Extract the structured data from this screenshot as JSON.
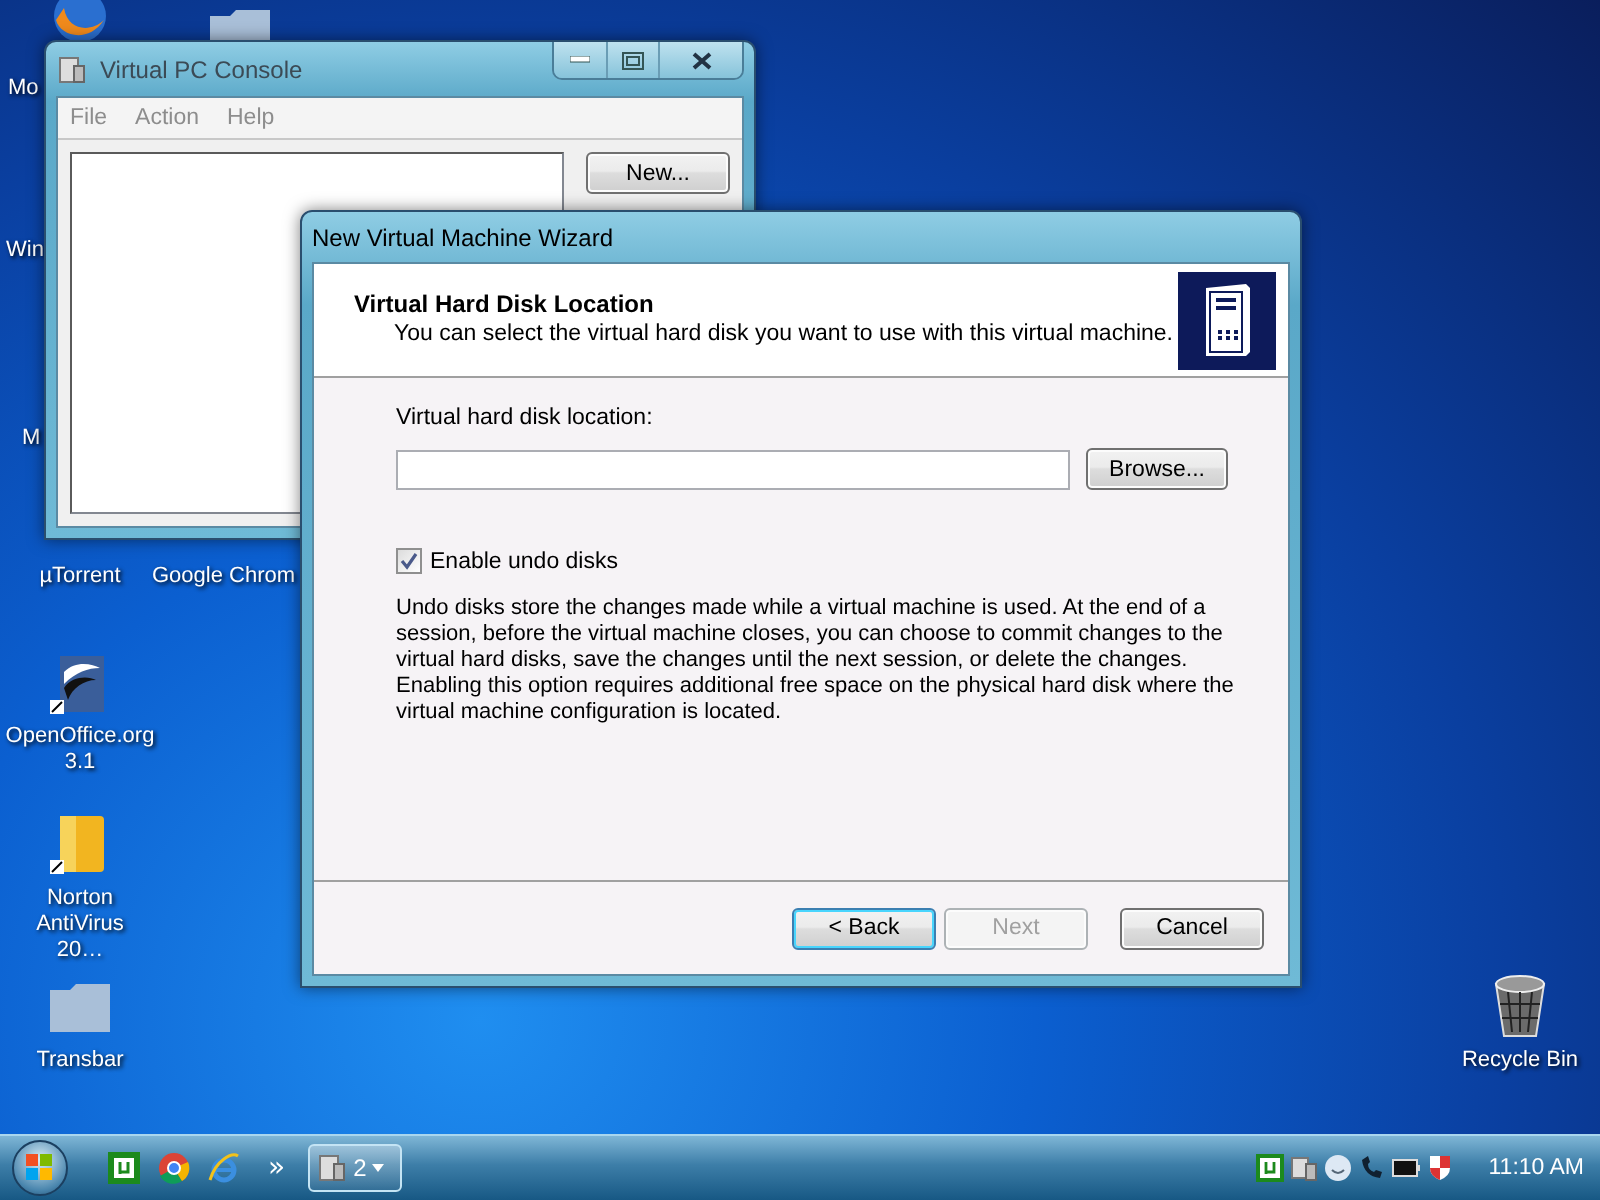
{
  "desktop": {
    "icons": [
      {
        "label": "Mo",
        "kind": "browser"
      },
      {
        "label": "Win",
        "kind": "hidden"
      },
      {
        "label": "M",
        "kind": "hidden"
      },
      {
        "label": "µTorrent",
        "kind": "hidden"
      },
      {
        "label": "Google Chrom",
        "kind": "folder-top"
      },
      {
        "label": "OpenOffice.org 3.1",
        "kind": "office"
      },
      {
        "label": "Norton AntiVirus 20…",
        "kind": "norton"
      },
      {
        "label": "Transbar",
        "kind": "folder"
      },
      {
        "label": "Recycle Bin",
        "kind": "recycle"
      }
    ]
  },
  "console_window": {
    "title": "Virtual PC Console",
    "menu": [
      "File",
      "Action",
      "Help"
    ],
    "new_button": "New..."
  },
  "wizard": {
    "title": "New Virtual Machine Wizard",
    "heading": "Virtual Hard Disk Location",
    "subheading": "You can select the virtual hard disk you want to use with this virtual machine.",
    "field_label": "Virtual hard disk location:",
    "browse_button": "Browse...",
    "undo_checkbox": {
      "label": "Enable undo disks",
      "checked": true
    },
    "description": "Undo disks store the changes made while a virtual machine is used. At the end of a session, before the virtual machine closes, you can choose to commit changes to the virtual hard disks, save the changes until the next session, or delete the changes. Enabling this option requires additional free space on the physical hard disk where the virtual machine configuration is located.",
    "buttons": [
      {
        "label": "< Back",
        "disabled": false,
        "default": true
      },
      {
        "label": "Next",
        "disabled": true,
        "default": false
      },
      {
        "label": "Cancel",
        "disabled": false,
        "default": false
      }
    ]
  },
  "taskbar": {
    "more": "»",
    "task_count": "2",
    "clock": "11:10 AM"
  }
}
